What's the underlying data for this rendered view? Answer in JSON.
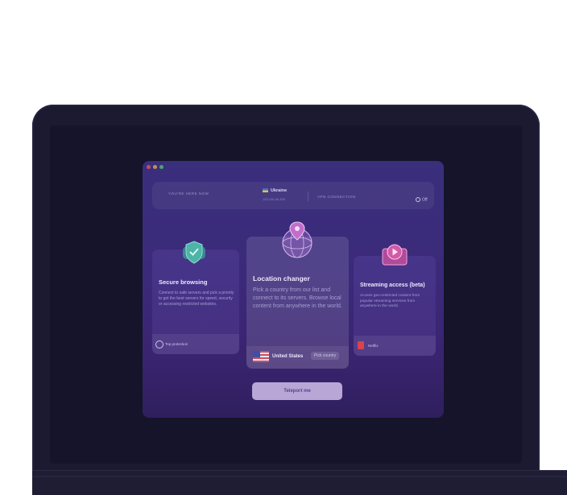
{
  "header": {
    "you_are_here_label": "YOU'RE HERE NOW",
    "country": "Ukraine",
    "ip": "193.108.36.395",
    "vpn_label": "VPN CONNECTION",
    "vpn_status": "Off"
  },
  "cards": {
    "secure": {
      "title": "Secure browsing",
      "desc": "Connect to safe servers and pick a priority to get the best servers for speed, security or accessing restricted websites.",
      "footer": "Top protection"
    },
    "location": {
      "title": "Location changer",
      "desc": "Pick a country from our list and connect to its servers. Browse local content from anywhere in the world.",
      "country": "United States",
      "pick_label": "Pick country"
    },
    "streaming": {
      "title": "Streaming access (beta)",
      "desc": "Access geo-restricted content from popular streaming services from anywhere in the world.",
      "footer": "Netflix"
    }
  },
  "teleport_label": "Teleport me",
  "icons": [
    "shield-icon",
    "globe-pin-icon",
    "play-icon",
    "power-icon",
    "us-flag-icon",
    "ukraine-flag-icon",
    "netflix-icon"
  ]
}
